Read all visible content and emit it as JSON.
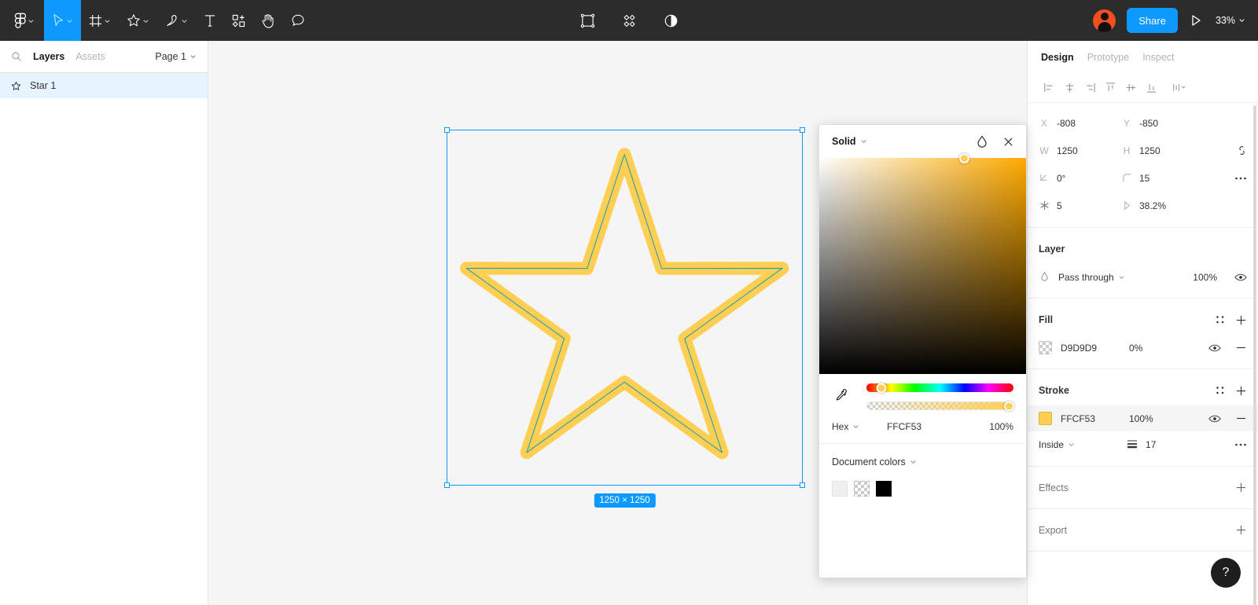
{
  "toolbar": {
    "left_tools": [
      {
        "name": "figma-menu",
        "icon": "figma-logo-icon",
        "has_caret": true,
        "active": false
      },
      {
        "name": "move-tool",
        "icon": "cursor-icon",
        "has_caret": true,
        "active": true
      },
      {
        "name": "frame-tool",
        "icon": "frame-icon",
        "has_caret": true,
        "active": false
      },
      {
        "name": "shape-tool",
        "icon": "star-icon",
        "has_caret": true,
        "active": false
      },
      {
        "name": "pen-tool",
        "icon": "pen-icon",
        "has_caret": true,
        "active": false
      },
      {
        "name": "text-tool",
        "icon": "text-icon",
        "has_caret": false,
        "active": false
      },
      {
        "name": "resources-tool",
        "icon": "components-icon",
        "has_caret": false,
        "active": false
      },
      {
        "name": "hand-tool",
        "icon": "hand-icon",
        "has_caret": false,
        "active": false
      },
      {
        "name": "comment-tool",
        "icon": "comment-icon",
        "has_caret": false,
        "active": false
      }
    ],
    "center_tools": [
      {
        "name": "selection-tool",
        "icon": "selection-box-icon"
      },
      {
        "name": "components-view",
        "icon": "diamonds-icon"
      },
      {
        "name": "contrast-tool",
        "icon": "contrast-icon"
      }
    ],
    "avatar_name": "user-avatar",
    "share_label": "Share",
    "present_icon": "play-icon",
    "zoom_level": "33%",
    "accent_color": "#0d99ff",
    "bar_color": "#2c2c2c"
  },
  "left_panel": {
    "search_icon": "search-icon",
    "tabs": [
      {
        "label": "Layers",
        "active": true
      },
      {
        "label": "Assets",
        "active": false
      }
    ],
    "page_label": "Page 1",
    "layers": [
      {
        "icon": "star-icon",
        "name": "Star 1",
        "selected": true
      }
    ]
  },
  "canvas": {
    "background": "#f5f5f5",
    "selection": {
      "dimension_badge": "1250 × 1250",
      "border_color": "#0d99ff"
    },
    "shape": {
      "type": "star",
      "points": 5,
      "stroke_color": "#FFCF53",
      "stroke_width": 17,
      "outline_color": "#1b9ab5",
      "fill_color": "#D9D9D9",
      "fill_opacity": "0%"
    }
  },
  "right_panel": {
    "tabs": [
      {
        "label": "Design",
        "active": true
      },
      {
        "label": "Prototype",
        "active": false
      },
      {
        "label": "Inspect",
        "active": false
      }
    ],
    "align_buttons": [
      "align-left-icon",
      "align-horizontal-center-icon",
      "align-right-icon",
      "align-top-icon",
      "align-vertical-center-icon",
      "align-bottom-icon",
      "distribute-icon"
    ],
    "properties": {
      "x_label": "X",
      "x_value": "-808",
      "y_label": "Y",
      "y_value": "-850",
      "w_label": "W",
      "w_value": "1250",
      "h_label": "H",
      "h_value": "1250",
      "constrain_icon": "constrain-proportions-icon",
      "rotation_icon": "rotation-icon",
      "rotation_value": "0°",
      "corner_icon": "corner-radius-icon",
      "corner_value": "15",
      "more_icon": "more-options-icon",
      "points_icon": "star-points-icon",
      "points_value": "5",
      "ratio_icon": "star-ratio-icon",
      "ratio_value": "38.2%"
    },
    "layer_section": {
      "title": "Layer",
      "blend_icon": "blend-mode-icon",
      "blend_mode": "Pass through",
      "opacity": "100%",
      "visibility_icon": "eye-icon"
    },
    "fill_section": {
      "title": "Fill",
      "style_icon": "styles-icon",
      "add_icon": "plus-icon",
      "items": [
        {
          "swatch_type": "checker",
          "hex": "D9D9D9",
          "opacity": "0%",
          "visibility_icon": "eye-icon",
          "remove_icon": "minus-icon"
        }
      ]
    },
    "stroke_section": {
      "title": "Stroke",
      "style_icon": "styles-icon",
      "add_icon": "plus-icon",
      "items": [
        {
          "swatch_color": "#FFCF53",
          "hex": "FFCF53",
          "opacity": "100%",
          "visibility_icon": "eye-icon",
          "remove_icon": "minus-icon",
          "selected": true
        }
      ],
      "align": "Inside",
      "weight_icon": "stroke-weight-icon",
      "weight": "17",
      "more_icon": "more-options-icon"
    },
    "effects_section": {
      "title": "Effects",
      "add_icon": "plus-icon"
    },
    "export_section": {
      "title": "Export",
      "add_icon": "plus-icon"
    }
  },
  "color_picker": {
    "mode": "Solid",
    "mode_caret_icon": "chevron-down-icon",
    "styles_icon": "color-styles-icon",
    "close_icon": "close-icon",
    "eyedropper_icon": "eyedropper-icon",
    "format_label": "Hex",
    "hex_value": "FFCF53",
    "opacity_value": "100%",
    "document_colors_label": "Document colors",
    "document_colors": [
      {
        "name": "white-swatch",
        "type": "solid",
        "color": "#f0f0f0"
      },
      {
        "name": "transparent-swatch",
        "type": "checker",
        "color": ""
      },
      {
        "name": "black-swatch",
        "type": "solid",
        "color": "#000000"
      }
    ]
  },
  "help": {
    "label": "?"
  }
}
